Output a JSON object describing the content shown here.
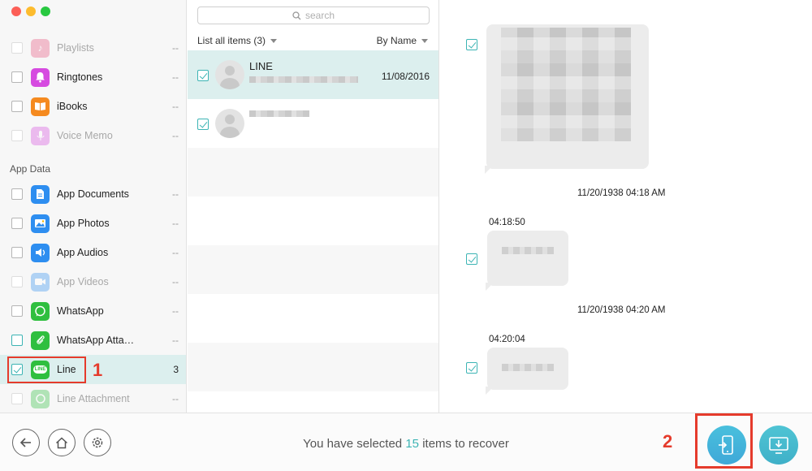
{
  "sidebar": {
    "section_app_data": "App Data",
    "items": [
      {
        "label": "Playlists",
        "count": "--"
      },
      {
        "label": "Ringtones",
        "count": "--"
      },
      {
        "label": "iBooks",
        "count": "--"
      },
      {
        "label": "Voice Memo",
        "count": "--"
      },
      {
        "label": "App Documents",
        "count": "--"
      },
      {
        "label": "App Photos",
        "count": "--"
      },
      {
        "label": "App Audios",
        "count": "--"
      },
      {
        "label": "App Videos",
        "count": "--"
      },
      {
        "label": "WhatsApp",
        "count": "--"
      },
      {
        "label": "WhatsApp Atta…",
        "count": "--"
      },
      {
        "label": "Line",
        "count": "3"
      },
      {
        "label": "Line Attachment",
        "count": "--"
      }
    ],
    "line_icon_text": "LINE"
  },
  "annotations": {
    "step1": "1",
    "step2": "2"
  },
  "list": {
    "search_placeholder": "search",
    "filter_label": "List all items (3)",
    "sort_label": "By Name",
    "rows": [
      {
        "name": "LINE",
        "date": "11/08/2016"
      }
    ]
  },
  "chat": {
    "messages": [
      {
        "date_header": "11/20/1938 04:18 AM",
        "time": "04:18:50"
      },
      {
        "date_header": "11/20/1938 04:20 AM",
        "time": "04:20:04"
      }
    ]
  },
  "bottom": {
    "status_prefix": "You have selected",
    "status_count": "15",
    "status_suffix": "items to recover"
  },
  "colors": {
    "accent": "#3cb4b4",
    "highlight": "#e53b2c",
    "line_green": "#2fbf3f"
  }
}
